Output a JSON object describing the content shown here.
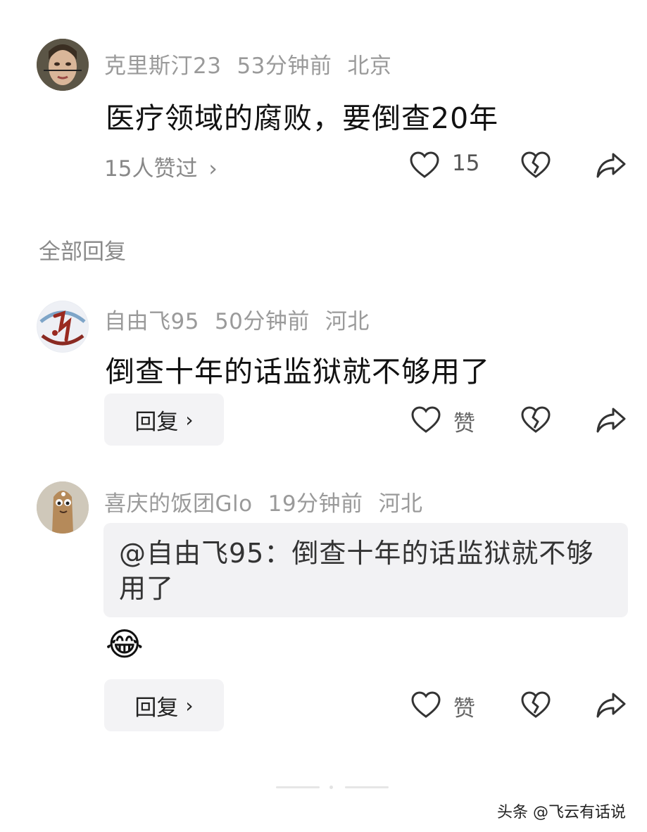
{
  "comment": {
    "username": "克里斯汀23",
    "time": "53分钟前",
    "location": "北京",
    "text": "医疗领域的腐败，要倒查20年",
    "likers_text": "15人赞过",
    "like_count": "15"
  },
  "section_title": "全部回复",
  "replies": [
    {
      "username": "自由飞95",
      "time": "50分钟前",
      "location": "河北",
      "text": "倒查十年的话监狱就不够用了",
      "reply_label": "回复",
      "like_label": "赞"
    },
    {
      "username": "喜庆的饭团Glo",
      "time": "19分钟前",
      "location": "河北",
      "quote": "@自由飞95：倒查十年的话监狱就不够用了",
      "emoji": "😂",
      "reply_label": "回复",
      "like_label": "赞"
    }
  ],
  "watermark": "头条 @飞云有话说",
  "colors": {
    "meta": "#9a9a9a",
    "quote_bg": "#f2f2f4",
    "button_bg": "#f3f3f5"
  }
}
